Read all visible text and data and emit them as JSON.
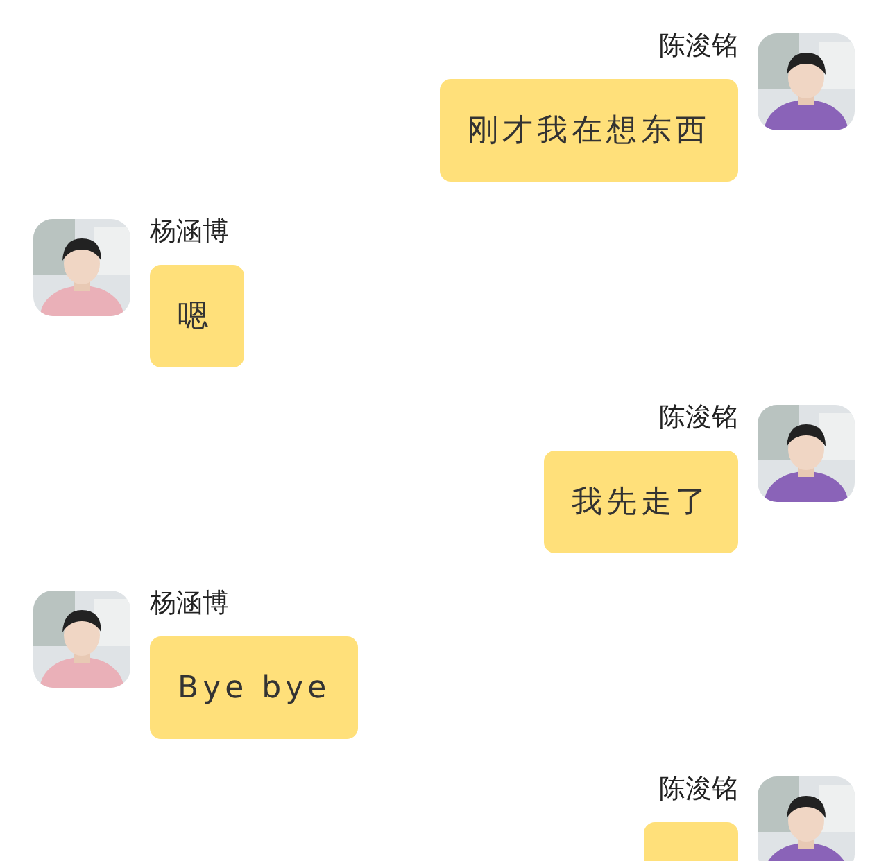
{
  "messages": [
    {
      "kind": "outgoing",
      "sender": "陈浚铭",
      "text": "刚才我在想东西"
    },
    {
      "kind": "incoming",
      "sender": "杨涵博",
      "text": "嗯"
    },
    {
      "kind": "outgoing",
      "sender": "陈浚铭",
      "text": "我先走了"
    },
    {
      "kind": "incoming",
      "sender": "杨涵博",
      "text": "Bye bye"
    },
    {
      "kind": "outgoing",
      "sender": "陈浚铭"
    }
  ]
}
